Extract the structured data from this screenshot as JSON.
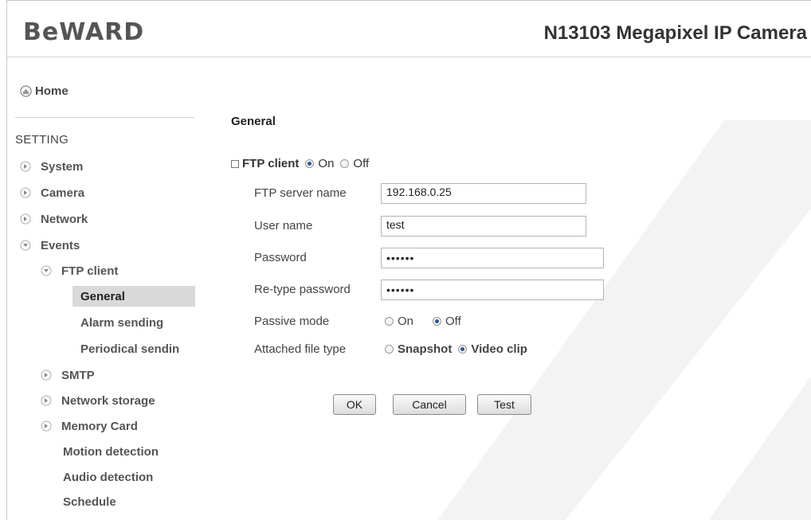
{
  "header": {
    "logo": "BeWARD",
    "camera_title": "N13103 Megapixel IP Camera"
  },
  "sidebar": {
    "home": "Home",
    "setting_label": "SETTING",
    "items": [
      {
        "label": "System"
      },
      {
        "label": "Camera"
      },
      {
        "label": "Network"
      },
      {
        "label": "Events"
      },
      {
        "label": "FTP client"
      },
      {
        "label": "General"
      },
      {
        "label": "Alarm sending"
      },
      {
        "label": "Periodical sendin"
      },
      {
        "label": "SMTP"
      },
      {
        "label": "Network storage"
      },
      {
        "label": "Memory Card"
      },
      {
        "label": "Motion detection"
      },
      {
        "label": "Audio detection"
      },
      {
        "label": "Schedule"
      }
    ]
  },
  "main": {
    "section_title": "General",
    "ftp_client": {
      "label": "FTP client",
      "on_label": "On",
      "off_label": "Off",
      "selected": "On"
    },
    "fields": {
      "server_name_label": "FTP server name",
      "server_name_value": "192.168.0.25",
      "user_name_label": "User name",
      "user_name_value": "test",
      "password_label": "Password",
      "password_value": "••••••",
      "retype_label": "Re-type password",
      "retype_value": "••••••"
    },
    "passive_mode": {
      "label": "Passive mode",
      "on_label": "On",
      "off_label": "Off",
      "selected": "Off"
    },
    "attached_file_type": {
      "label": "Attached file type",
      "snapshot_label": "Snapshot",
      "video_label": "Video clip",
      "selected": "Video clip"
    },
    "buttons": {
      "ok": "OK",
      "cancel": "Cancel",
      "test": "Test"
    }
  },
  "colors": {
    "accent": "#2a55a0",
    "active_bg": "#d9d9d9",
    "watermark": "#f2f2f2"
  }
}
